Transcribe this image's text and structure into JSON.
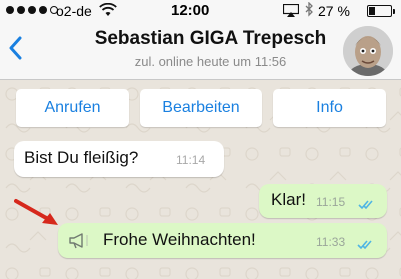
{
  "status_bar": {
    "carrier": "o2-de",
    "time": "12:00",
    "battery_percent": "27 %",
    "battery_level": 0.27,
    "signal_bars_filled": 4,
    "signal_bars_total": 5
  },
  "header": {
    "title": "Sebastian GIGA Trepesch",
    "subtitle": "zul. online heute um 11:56"
  },
  "actions": [
    {
      "label": "Anrufen"
    },
    {
      "label": "Bearbeiten"
    },
    {
      "label": "Info"
    }
  ],
  "messages": [
    {
      "text": "Bist Du fleißig?",
      "time": "11:14",
      "direction": "in"
    },
    {
      "text": "Klar!",
      "time": "11:15",
      "direction": "out"
    },
    {
      "text": "Frohe Weihnachten!",
      "time": "11:33",
      "direction": "out",
      "icon": "megaphone-icon"
    }
  ],
  "colors": {
    "accent": "#1a80e0",
    "outgoing_bubble": "#dcf8c6",
    "incoming_bubble": "#ffffff",
    "chat_background": "#e9e4dc",
    "read_checks": "#4fb5e4",
    "annotation_arrow": "#d6281c"
  }
}
